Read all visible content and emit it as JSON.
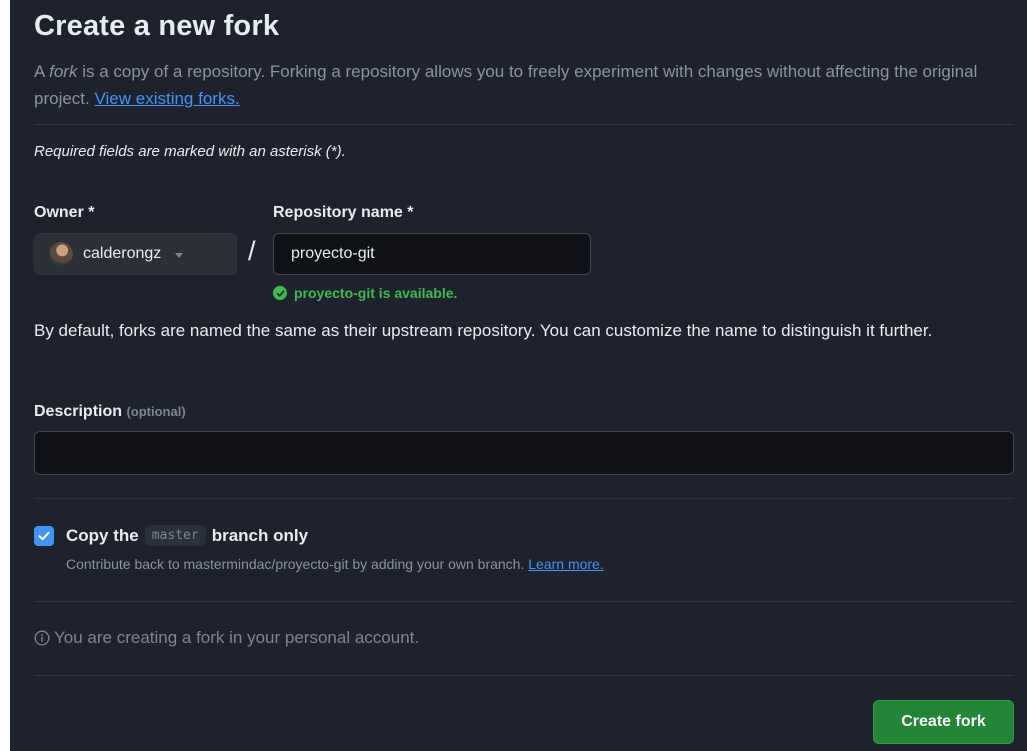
{
  "header": {
    "title": "Create a new fork",
    "intro_prefix": "A ",
    "intro_em": "fork",
    "intro_rest": " is a copy of a repository. Forking a repository allows you to freely experiment with changes without affecting the original project. ",
    "view_forks_link": "View existing forks."
  },
  "form": {
    "required_note": "Required fields are marked with an asterisk (*).",
    "owner_label": "Owner *",
    "owner_value": "calderongz",
    "separator": "/",
    "repo_label": "Repository name *",
    "repo_value": "proyecto-git",
    "availability": "proyecto-git is available.",
    "naming_note": "By default, forks are named the same as their upstream repository. You can customize the name to distinguish it further.",
    "description_label": "Description",
    "description_optional": "(optional)",
    "description_value": "",
    "copy_branch_prefix": "Copy the",
    "copy_branch_name": "master",
    "copy_branch_suffix": "branch only",
    "copy_branch_checked": true,
    "contribute_text": "Contribute back to mastermindac/proyecto-git by adding your own branch. ",
    "learn_more_link": "Learn more.",
    "personal_account_note": "You are creating a fork in your personal account.",
    "create_button": "Create fork"
  },
  "colors": {
    "background": "#1e222d",
    "link": "#4493f8",
    "success": "#3fb950",
    "primary_button": "#238636",
    "checkbox": "#4493f8"
  },
  "icons": {
    "availability": "check-circle-icon",
    "dropdown": "chevron-down-icon",
    "info": "info-icon",
    "checkbox": "checkmark-icon"
  }
}
